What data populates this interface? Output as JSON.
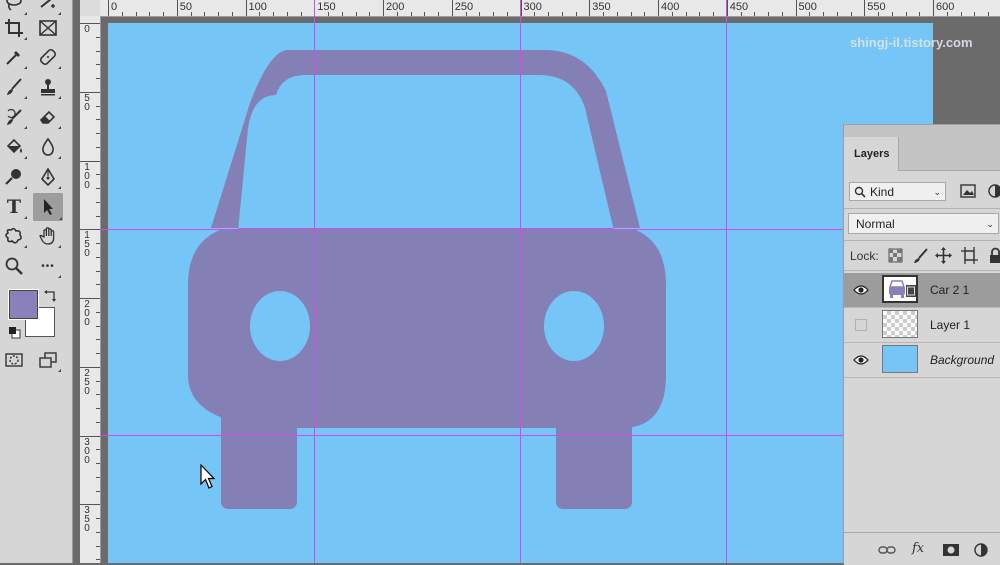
{
  "toolbar": {
    "tools": [
      {
        "name": "lasso-tool",
        "icon": "lasso-icon"
      },
      {
        "name": "quick-selection-tool",
        "icon": "quick-select-icon"
      },
      {
        "name": "crop-tool",
        "icon": "crop-icon"
      },
      {
        "name": "frame-tool",
        "icon": "frame-icon"
      },
      {
        "name": "eyedropper-tool",
        "icon": "eyedropper-icon"
      },
      {
        "name": "healing-brush-tool",
        "icon": "bandage-icon"
      },
      {
        "name": "brush-tool",
        "icon": "brush-icon"
      },
      {
        "name": "clone-stamp-tool",
        "icon": "stamp-icon"
      },
      {
        "name": "history-brush-tool",
        "icon": "history-brush-icon"
      },
      {
        "name": "eraser-tool",
        "icon": "eraser-icon"
      },
      {
        "name": "paint-bucket-tool",
        "icon": "bucket-icon"
      },
      {
        "name": "blur-tool",
        "icon": "drop-icon"
      },
      {
        "name": "dodge-tool",
        "icon": "dodge-icon"
      },
      {
        "name": "pen-tool",
        "icon": "pen-icon"
      },
      {
        "name": "type-tool",
        "icon": "type-icon",
        "label": "T"
      },
      {
        "name": "path-selection-tool",
        "icon": "arrow-icon"
      },
      {
        "name": "custom-shape-tool",
        "icon": "shape-icon"
      },
      {
        "name": "hand-tool",
        "icon": "hand-icon"
      },
      {
        "name": "zoom-tool",
        "icon": "zoom-icon"
      },
      {
        "name": "more-tools",
        "icon": "ellipsis-icon",
        "label": "•••"
      }
    ],
    "foreground_color": "#8a81bc",
    "background_color": "#ffffff"
  },
  "ruler": {
    "h_labels": [
      "0",
      "50",
      "100",
      "150",
      "200",
      "250",
      "300",
      "350",
      "400",
      "450",
      "500",
      "550",
      "600"
    ],
    "v_labels": [
      "0",
      "50",
      "100",
      "150",
      "200",
      "250",
      "300",
      "350"
    ]
  },
  "canvas": {
    "background_color": "#75c5f7",
    "shape_color": "#8480b5",
    "guide_color": "#d649e8",
    "watermark": "shingj-il.tistory.com"
  },
  "layers_panel": {
    "tab_label": "Layers",
    "filter_kind": "Kind",
    "blend_mode": "Normal",
    "lock_label": "Lock:",
    "layers": [
      {
        "name": "Car 2 1",
        "visible": true,
        "selected": true,
        "italic": false
      },
      {
        "name": "Layer 1",
        "visible": false,
        "selected": false,
        "italic": false
      },
      {
        "name": "Background",
        "visible": true,
        "selected": false,
        "italic": true
      }
    ],
    "footer_fx": "fx"
  }
}
